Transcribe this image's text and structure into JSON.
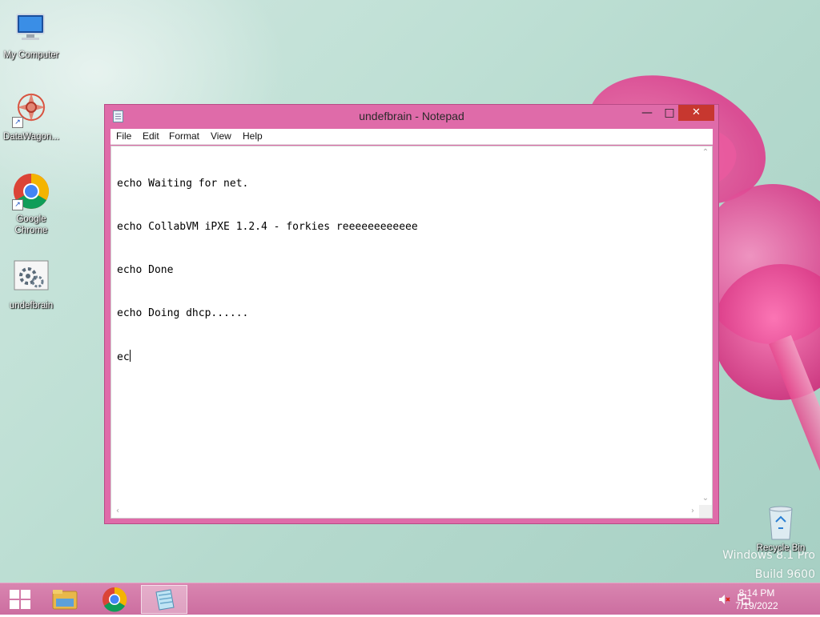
{
  "desktop": {
    "icons": [
      {
        "label": "My Computer",
        "icon": "computer-icon"
      },
      {
        "label": "DataWagon...",
        "icon": "datawagon-icon"
      },
      {
        "label": "Google Chrome",
        "icon": "chrome-icon"
      },
      {
        "label": "undefbrain",
        "icon": "batch-file-icon"
      },
      {
        "label": "Recycle Bin",
        "icon": "recycle-bin-icon"
      }
    ],
    "watermark": {
      "line1": "Windows 8.1 Pro",
      "line2": "Build 9600"
    }
  },
  "notepad": {
    "title": "undefbrain - Notepad",
    "controls": {
      "minimize": "—",
      "maximize": "□",
      "close": "✕"
    },
    "menu": [
      "File",
      "Edit",
      "Format",
      "View",
      "Help"
    ],
    "lines": [
      "echo Waiting for net.",
      "echo CollabVM iPXE 1.2.4 - forkies reeeeeeeeeeee",
      "echo Done",
      "echo Doing dhcp......",
      "ec"
    ]
  },
  "taskbar": {
    "items": [
      "file-explorer-icon",
      "chrome-icon",
      "notepad-icon"
    ],
    "active_item": "notepad-icon",
    "clock": {
      "time": "8:14 PM",
      "date": "7/19/2022"
    },
    "tray": [
      "volume-muted-icon",
      "network-icon"
    ]
  },
  "colors": {
    "accent": "#df6ba9",
    "close": "#c7372f",
    "taskbar": "#d27aa8"
  }
}
